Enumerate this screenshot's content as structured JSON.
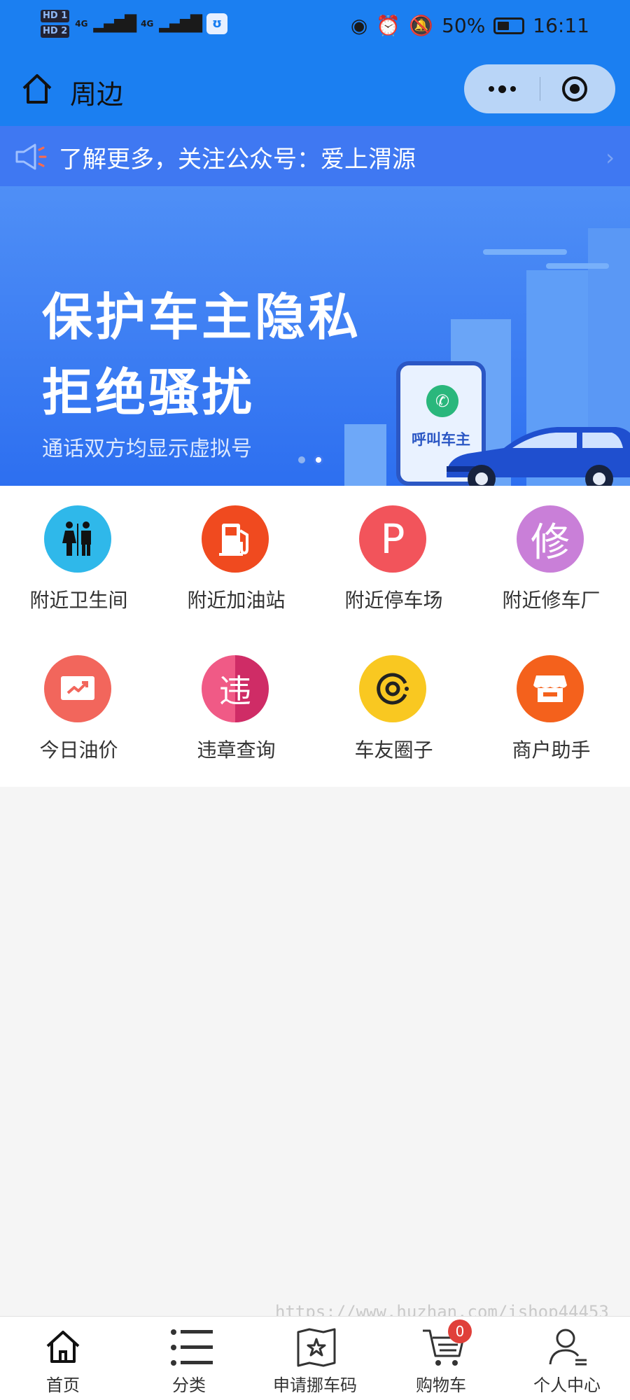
{
  "status_bar": {
    "battery": "50%",
    "time": "16:11",
    "network_1": "4G",
    "network_2": "4G",
    "hd1": "HD 1",
    "hd2": "HD 2"
  },
  "header": {
    "title": "周边"
  },
  "notice": {
    "text": "了解更多，关注公众号：爱上渭源"
  },
  "banner": {
    "line1": "保护车主隐私",
    "line2": "拒绝骚扰",
    "subtitle": "通话双方均显示虚拟号",
    "phone_label": "呼叫车主",
    "slide_count": 2,
    "active_slide": 2
  },
  "services": [
    {
      "label": "附近卫生间",
      "icon": "restroom-icon",
      "color": "#2fb8ea"
    },
    {
      "label": "附近加油站",
      "icon": "gas-station-icon",
      "color": "#f04a1f"
    },
    {
      "label": "附近停车场",
      "icon": "parking-icon",
      "color": "#f2545b",
      "glyph": "P"
    },
    {
      "label": "附近修车厂",
      "icon": "repair-icon",
      "color": "#c97fd8",
      "glyph": "修"
    },
    {
      "label": "今日油价",
      "icon": "oil-price-icon",
      "color": "#f2665c"
    },
    {
      "label": "违章查询",
      "icon": "violation-icon",
      "color": "#e33f79",
      "glyph": "违"
    },
    {
      "label": "车友圈子",
      "icon": "community-icon",
      "color": "#f9c821"
    },
    {
      "label": "商户助手",
      "icon": "merchant-icon",
      "color": "#f4611c"
    }
  ],
  "watermark": "https://www.huzhan.com/ishop44453",
  "tabbar": {
    "items": [
      {
        "label": "首页",
        "icon": "home-icon"
      },
      {
        "label": "分类",
        "icon": "category-list-icon"
      },
      {
        "label": "申请挪车码",
        "icon": "move-car-code-icon"
      },
      {
        "label": "购物车",
        "icon": "cart-icon",
        "badge": "0"
      },
      {
        "label": "个人中心",
        "icon": "user-icon"
      }
    ]
  }
}
